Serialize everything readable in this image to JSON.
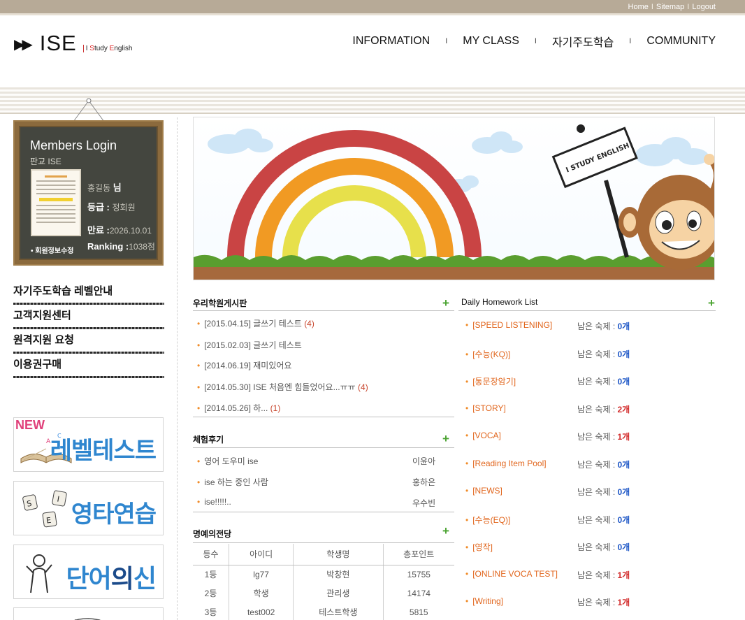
{
  "top_links": [
    "Home",
    "Sitemap",
    "Logout"
  ],
  "logo": {
    "arrows": "▶▶",
    "word": "ISE",
    "tag_i": "I ",
    "tag_s": "S",
    "tag_tudy": "tudy ",
    "tag_e": "E",
    "tag_nglish": "nglish"
  },
  "nav": [
    "INFORMATION",
    "MY CLASS",
    "자기주도학습",
    "COMMUNITY"
  ],
  "login": {
    "title": "Members Login",
    "subtitle": "판교 ISE",
    "name": "홍길동",
    "name_suffix": "님",
    "grade_label": "등급 :",
    "grade_value": "정회원",
    "expire_label": "만료 :",
    "expire_value": "2026.10.01",
    "ranking_label": "Ranking :",
    "ranking_value": "1038점",
    "edit_link": "• 회원정보수정"
  },
  "left_menu": [
    "자기주도학습 레벨안내",
    "고객지원센터",
    "원격지원 요청",
    "이용권구매"
  ],
  "banners": {
    "level_test": "레벨테스트",
    "level_test_new": "NEW",
    "typing": "영타연습",
    "word_god_a": "단어",
    "word_god_b": "의",
    "word_god_c": "신"
  },
  "hero": {
    "sign_text": "I STUDY ENGLISH"
  },
  "board": {
    "title": "우리학원게시판",
    "plus": "+",
    "posts": [
      {
        "text": "[2015.04.15] 글쓰기 테스트",
        "count": "(4)"
      },
      {
        "text": "[2015.02.03] 글쓰기 테스트",
        "count": ""
      },
      {
        "text": "[2014.06.19] 재미있어요",
        "count": ""
      },
      {
        "text": "[2014.05.30] ISE 처음엔 힘들었어요...ㅠㅠ",
        "count": "(4)"
      },
      {
        "text": "[2014.05.26] 하...",
        "count": "(1)"
      }
    ]
  },
  "reviews": {
    "title": "체험후기",
    "plus": "+",
    "items": [
      {
        "text": "영어 도우미 ise",
        "author": "이윤아"
      },
      {
        "text": "ise 하는 중인 사람",
        "author": "홍하은"
      },
      {
        "text": "ise!!!!!..",
        "author": "우수빈"
      }
    ]
  },
  "hall": {
    "title": "명예의전당",
    "plus": "+",
    "headers": [
      "등수",
      "아이디",
      "학생명",
      "총포인트"
    ],
    "rows": [
      [
        "1등",
        "lg77",
        "박창현",
        "15755"
      ],
      [
        "2등",
        "학생",
        "관리생",
        "14174"
      ],
      [
        "3등",
        "test002",
        "테스트학생",
        "5815"
      ]
    ]
  },
  "homework": {
    "title": "Daily Homework List",
    "plus": "+",
    "remain_label": "남은 숙제 : ",
    "items": [
      {
        "name": "[SPEED LISTENING]",
        "count": "0개",
        "red": false
      },
      {
        "name": "[수능(KQ)]",
        "count": "0개",
        "red": false
      },
      {
        "name": "[통문장암기]",
        "count": "0개",
        "red": false
      },
      {
        "name": "[STORY]",
        "count": "2개",
        "red": true
      },
      {
        "name": "[VOCA]",
        "count": "1개",
        "red": true
      },
      {
        "name": "[Reading Item Pool]",
        "count": "0개",
        "red": false
      },
      {
        "name": "[NEWS]",
        "count": "0개",
        "red": false
      },
      {
        "name": "[수능(EQ)]",
        "count": "0개",
        "red": false
      },
      {
        "name": "[영작]",
        "count": "0개",
        "red": false
      },
      {
        "name": "[ONLINE VOCA TEST]",
        "count": "1개",
        "red": true
      },
      {
        "name": "[Writing]",
        "count": "1개",
        "red": true
      }
    ]
  },
  "colors": {
    "accent_orange": "#e1651c",
    "plus_green": "#4aa331",
    "count_blue": "#1d56c6",
    "count_red": "#d22a2a",
    "board_green": "#44463f"
  }
}
